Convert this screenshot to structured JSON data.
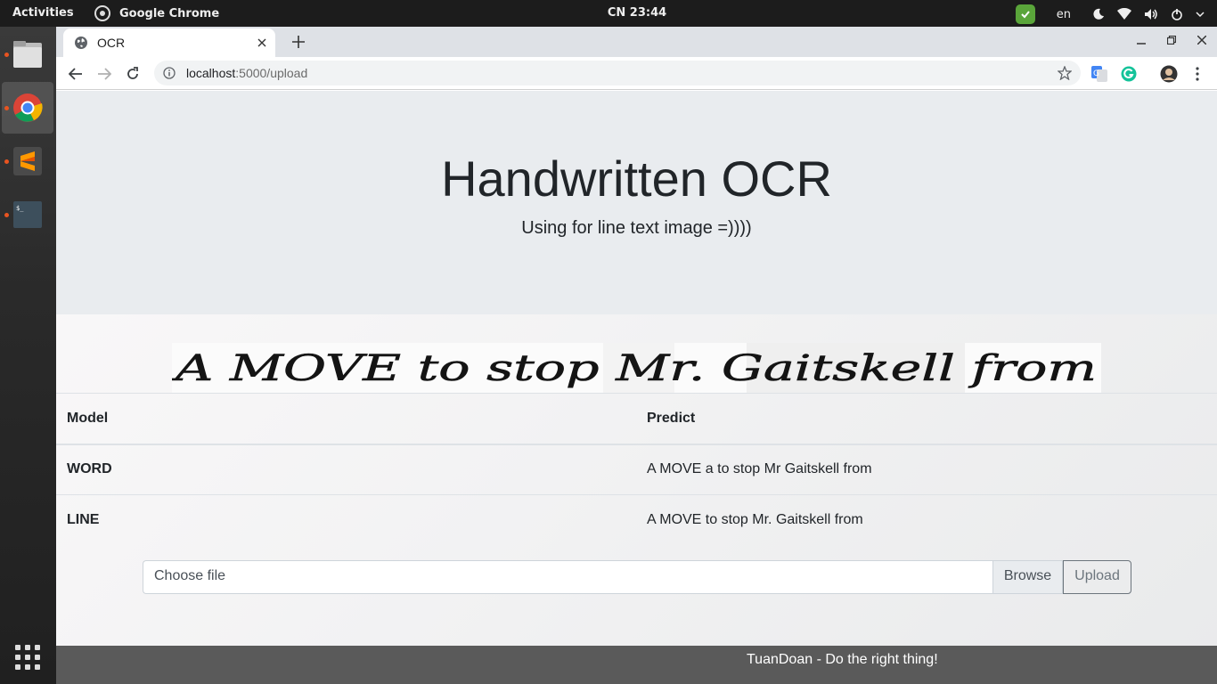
{
  "topbar": {
    "activities": "Activities",
    "app_name": "Google Chrome",
    "clock": "CN 23:44",
    "lang": "en"
  },
  "dock": {
    "items": [
      "files-icon",
      "chrome-icon",
      "sublime-text-icon",
      "terminal-icon"
    ],
    "accent": "#e95420"
  },
  "browser": {
    "tab_title": "OCR",
    "url_host": "localhost",
    "url_path": ":5000/upload"
  },
  "page": {
    "heading": "Handwritten OCR",
    "subheading": "Using for line text image =))))",
    "handwriting_text": "A MOVE to stop Mr. Gaitskell from",
    "table": {
      "headers": [
        "Model",
        "Predict"
      ],
      "rows": [
        {
          "model": "WORD",
          "predict": "A MOVE a to stop Mr Gaitskell from"
        },
        {
          "model": "LINE",
          "predict": "A MOVE to stop Mr. Gaitskell from"
        }
      ]
    },
    "upload": {
      "placeholder": "Choose file",
      "browse_label": "Browse",
      "upload_label": "Upload"
    },
    "footer": "TuanDoan - Do the right thing!"
  },
  "colors": {
    "jumbotron_bg": "#e9ecef",
    "footer_bg": "#5a5a5a",
    "topbar_bg": "#1c1c1c"
  }
}
